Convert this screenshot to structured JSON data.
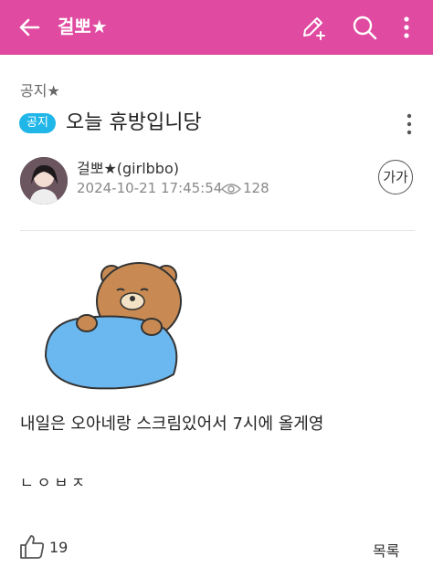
{
  "header": {
    "title": "걸뽀★",
    "back_icon": "arrow-left-icon",
    "write_icon": "pencil-plus-icon",
    "search_icon": "search-icon",
    "more_icon": "more-vertical-icon",
    "bg_color": "#e04aa0"
  },
  "post": {
    "category": "공지★",
    "badge": "공지",
    "title": "오늘 휴방입니당",
    "author": "걸뽀★(girlbbo)",
    "datetime": "2024-10-21 17:45:54",
    "views": "128",
    "font_size_label": "가가",
    "body_line1": "내일은 오아네랑 스크림있어서 7시에 올게영",
    "body_line2": "ㄴㅇㅂㅈ"
  },
  "footer": {
    "likes": "19",
    "list_label": "목록"
  }
}
